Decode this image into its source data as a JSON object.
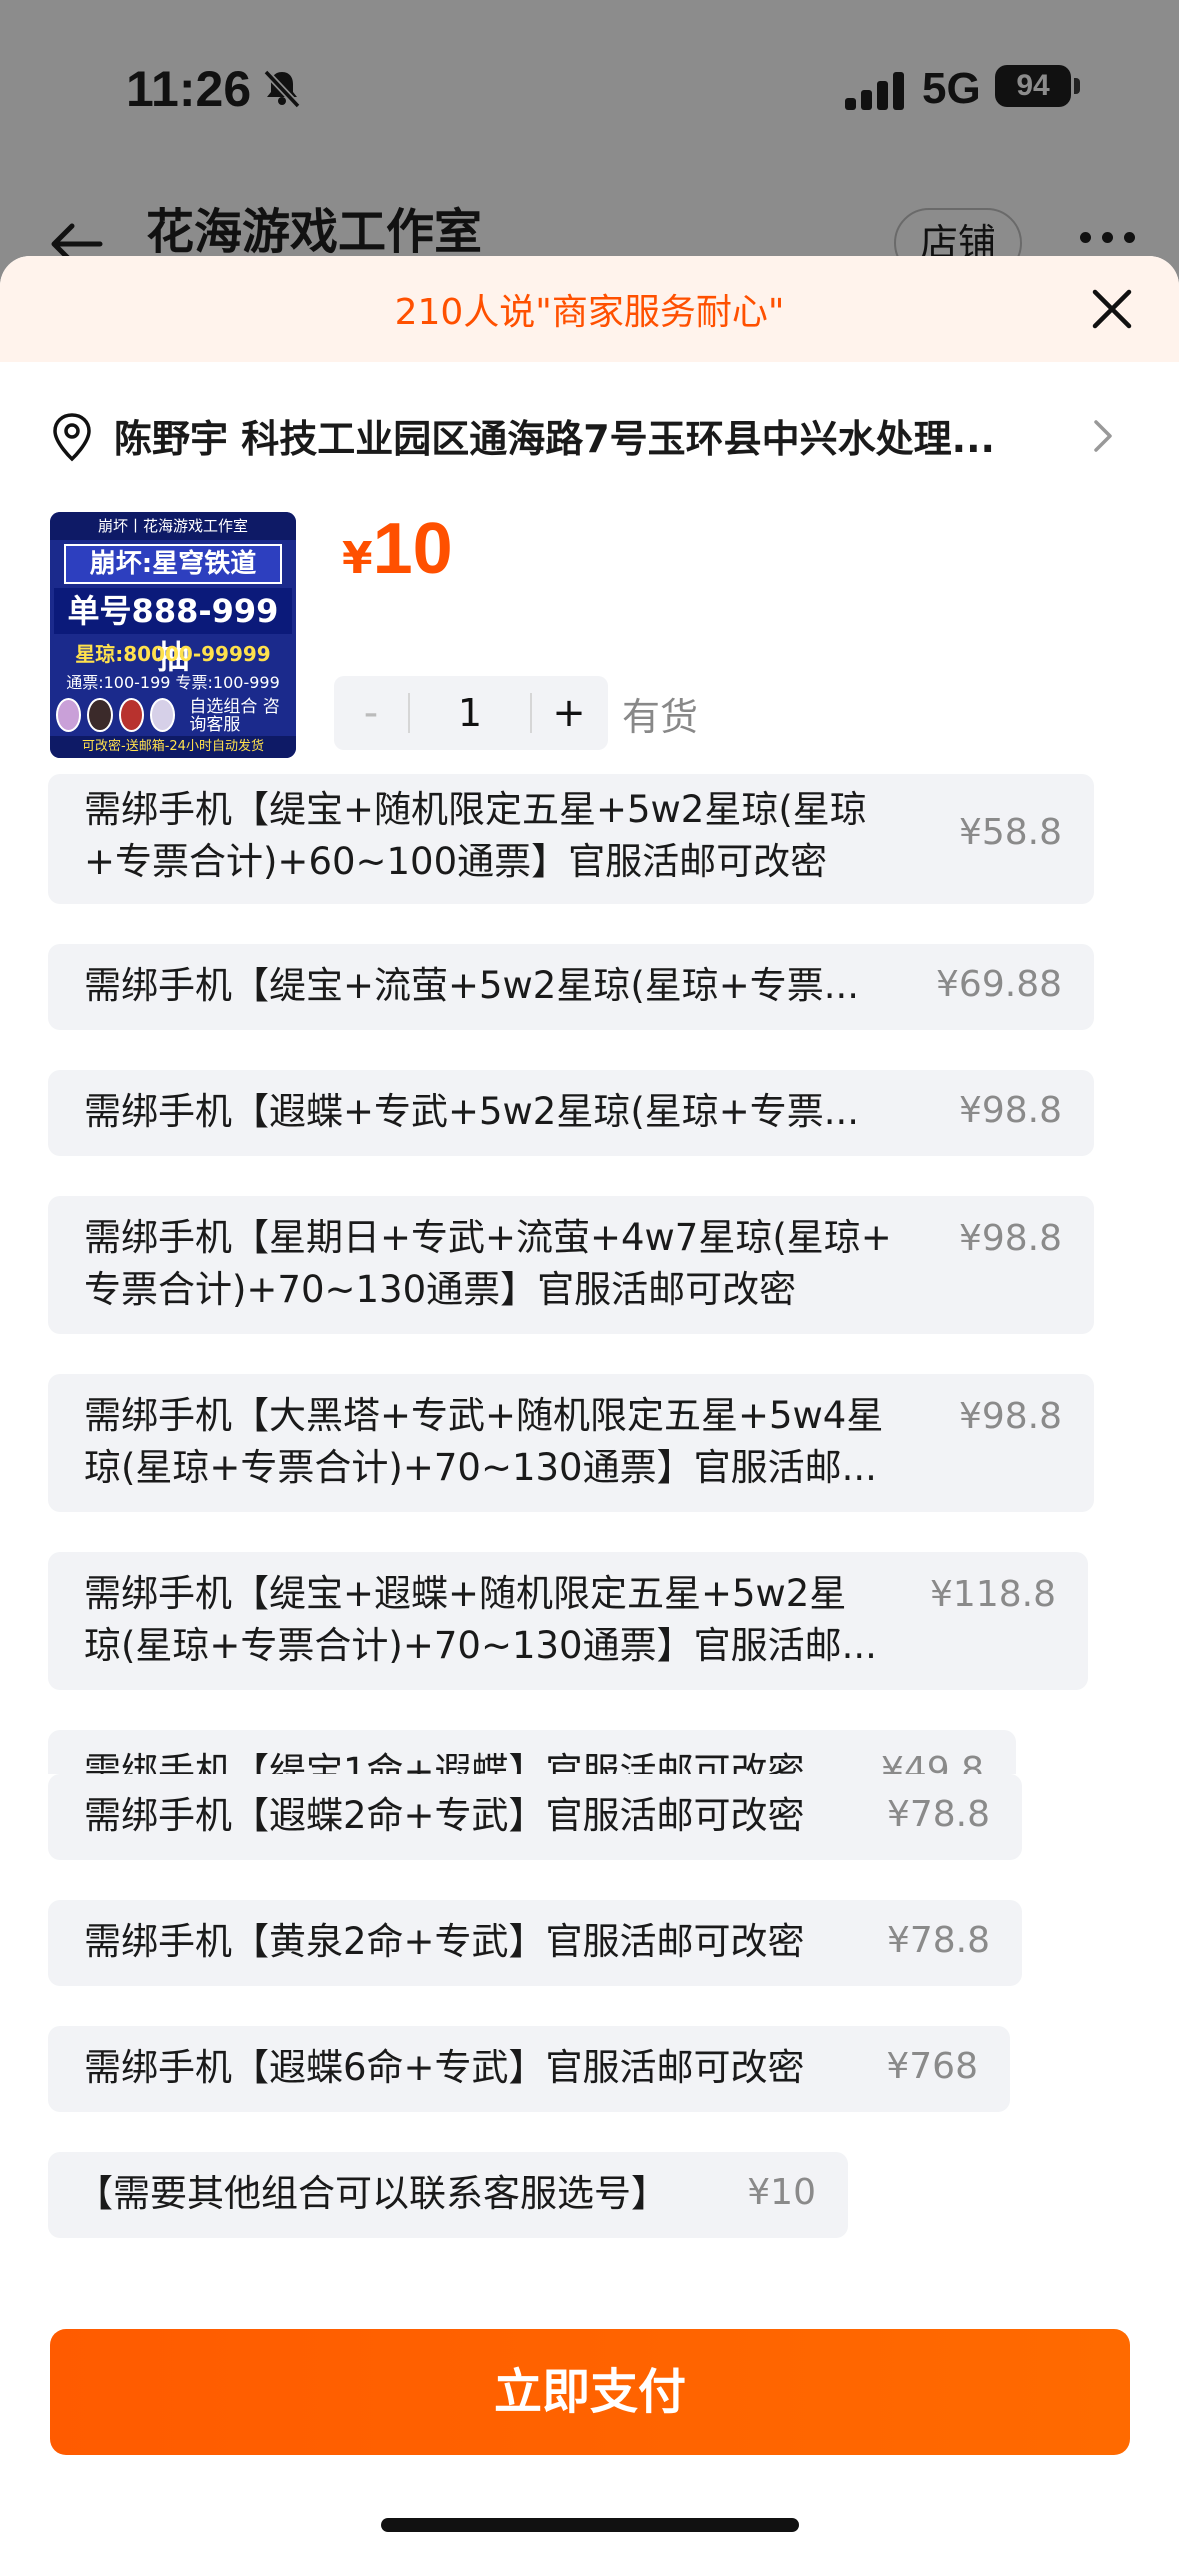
{
  "status_bar": {
    "time": "11:26",
    "network": "5G",
    "battery": "94"
  },
  "header": {
    "shop_title": "花海游戏工作室",
    "shop_button": "店铺"
  },
  "banner": {
    "text": "210人说\"商家服务耐心\""
  },
  "address": {
    "text": "陈野宇 科技工业园区通海路7号玉环县中兴水处理..."
  },
  "product": {
    "thumb": {
      "top": "崩坏丨花海游戏工作室",
      "game": "崩坏:星穹铁道",
      "num": "单号888-999抽",
      "star": "星琼:80000-99999",
      "pass": "通票:100-199 专票:100-999",
      "side": "自选组合 咨询客服",
      "foot": "可改密-送邮箱-24小时自动发货"
    },
    "currency": "¥",
    "price": "10",
    "quantity": "1",
    "minus": "-",
    "plus": "+",
    "stock": "有货"
  },
  "options": [
    {
      "line1": "需绑手机【缇宝+随机限定五星+5w2星琼(星琼",
      "line2": "+专票合计)+60~100通票】官服活邮可改密",
      "price": "¥58.8"
    },
    {
      "line1": "需绑手机【缇宝+流萤+5w2星琼(星琼+专票...",
      "line2": "",
      "price": "¥69.88"
    },
    {
      "line1": "需绑手机【遐蝶+专武+5w2星琼(星琼+专票...",
      "line2": "",
      "price": "¥98.8"
    },
    {
      "line1": "需绑手机【星期日+专武+流萤+4w7星琼(星琼+",
      "line2": "专票合计)+70~130通票】官服活邮可改密",
      "price": "¥98.8"
    },
    {
      "line1": "需绑手机【大黑塔+专武+随机限定五星+5w4星",
      "line2": "琼(星琼+专票合计)+70~130通票】官服活邮...",
      "price": "¥98.8"
    },
    {
      "line1": "需绑手机【缇宝+遐蝶+随机限定五星+5w2星",
      "line2": "琼(星琼+专票合计)+70~130通票】官服活邮...",
      "price": "¥118.8"
    },
    {
      "line1": "需绑手机【缇宝1命+遐蝶】官服活邮可改密",
      "line2": "",
      "price": "¥49.8"
    },
    {
      "line1": "需绑手机【遐蝶2命+专武】官服活邮可改密",
      "line2": "",
      "price": "¥78.8"
    },
    {
      "line1": "需绑手机【黄泉2命+专武】官服活邮可改密",
      "line2": "",
      "price": "¥78.8"
    },
    {
      "line1": "需绑手机【遐蝶6命+专武】官服活邮可改密",
      "line2": "",
      "price": "¥768"
    },
    {
      "line1": "【需要其他组合可以联系客服选号】",
      "line2": "",
      "price": "¥10"
    }
  ],
  "footer": {
    "pay_button": "立即支付"
  },
  "colors": {
    "accent": "#ff5000",
    "option_bg": "#f2f3f6",
    "banner_bg": "#fff3ec"
  }
}
